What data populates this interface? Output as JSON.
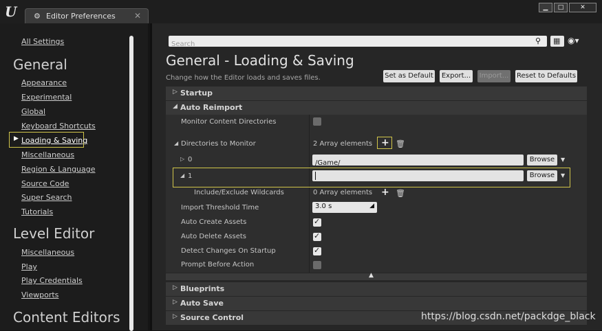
{
  "window": {
    "tab_title": "Editor Preferences",
    "logo_glyph": "U",
    "tab_icon_glyph": "⚙",
    "close_glyph": "✕",
    "controls": {
      "minimize": "▁",
      "maximize": "□",
      "close": "✕"
    }
  },
  "sidebar": {
    "top_item": "All Settings",
    "section1": {
      "title": "General",
      "items": [
        "Appearance",
        "Experimental",
        "Global",
        "Keyboard Shortcuts",
        "Loading & Saving",
        "Miscellaneous",
        "Region & Language",
        "Source Code",
        "Super Search",
        "Tutorials"
      ]
    },
    "section2": {
      "title": "Level Editor",
      "items": [
        "Miscellaneous",
        "Play",
        "Play Credentials",
        "Viewports"
      ]
    },
    "section3": {
      "title": "Content Editors"
    },
    "selected_item": "Loading & Saving"
  },
  "toolbar": {
    "search_placeholder": "Search"
  },
  "header": {
    "title": "General - Loading & Saving",
    "subtitle": "Change how the Editor loads and saves files.",
    "buttons": {
      "set_default": "Set as Default",
      "export": "Export...",
      "import": "Import...",
      "reset": "Reset to Defaults"
    }
  },
  "categories": {
    "startup": "Startup",
    "auto_reimport": "Auto Reimport",
    "blueprints": "Blueprints",
    "auto_save": "Auto Save",
    "source_control": "Source Control"
  },
  "auto_reimport": {
    "monitor_content_dirs": {
      "label": "Monitor Content Directories",
      "checked": false
    },
    "directories": {
      "label": "Directories to Monitor",
      "count_text": "2 Array elements"
    },
    "entry0": {
      "index": "0",
      "value": "/Game/",
      "browse": "Browse"
    },
    "entry1": {
      "index": "1",
      "value": "",
      "browse": "Browse"
    },
    "wildcards": {
      "label": "Include/Exclude Wildcards",
      "count_text": "0 Array elements"
    },
    "import_threshold": {
      "label": "Import Threshold Time",
      "value": "3.0 s"
    },
    "auto_create": {
      "label": "Auto Create Assets",
      "checked": true
    },
    "auto_delete": {
      "label": "Auto Delete Assets",
      "checked": true
    },
    "detect_changes": {
      "label": "Detect Changes On Startup",
      "checked": true
    },
    "prompt_before": {
      "label": "Prompt Before Action",
      "checked": false
    }
  },
  "watermark": "https://blog.csdn.net/packdge_black",
  "colors": {
    "selection_border": "#d2c64a",
    "panel": "#262626",
    "category": "#383838"
  }
}
